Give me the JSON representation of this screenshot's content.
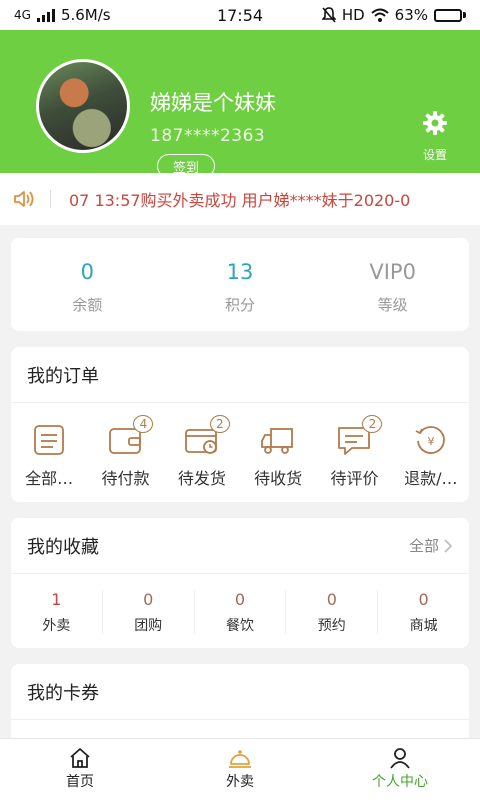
{
  "status_bar": {
    "network": "4G",
    "speed": "5.6M/s",
    "time": "17:54",
    "hd": "HD",
    "battery": "63%",
    "battery_level": 0.63
  },
  "profile": {
    "name": "娣娣是个妹妹",
    "phone": "187****2363",
    "checkin_label": "签到",
    "settings_label": "设置"
  },
  "notice": {
    "text": "07 13:57购买外卖成功   用户娣****妹于2020-0"
  },
  "stats": [
    {
      "value": "0",
      "label": "余额"
    },
    {
      "value": "13",
      "label": "积分"
    },
    {
      "value": "VIP0",
      "label": "等级"
    }
  ],
  "orders": {
    "title": "我的订单",
    "items": [
      {
        "label": "全部…",
        "icon": "clipboard-icon",
        "badge": ""
      },
      {
        "label": "待付款",
        "icon": "wallet-icon",
        "badge": "4"
      },
      {
        "label": "待发货",
        "icon": "card-clock-icon",
        "badge": "2"
      },
      {
        "label": "待收货",
        "icon": "truck-icon",
        "badge": ""
      },
      {
        "label": "待评价",
        "icon": "comment-icon",
        "badge": "2"
      },
      {
        "label": "退款/…",
        "icon": "refund-icon",
        "badge": ""
      }
    ]
  },
  "favorites": {
    "title": "我的收藏",
    "more_label": "全部",
    "items": [
      {
        "count": "1",
        "label": "外卖"
      },
      {
        "count": "0",
        "label": "团购"
      },
      {
        "count": "0",
        "label": "餐饮"
      },
      {
        "count": "0",
        "label": "预约"
      },
      {
        "count": "0",
        "label": "商城"
      }
    ]
  },
  "coupons": {
    "title": "我的卡券"
  },
  "tabbar": [
    {
      "label": "首页",
      "icon": "home-icon",
      "active": false
    },
    {
      "label": "外卖",
      "icon": "cloche-icon",
      "active": false
    },
    {
      "label": "个人中心",
      "icon": "person-icon",
      "active": true
    }
  ],
  "colors": {
    "brand_green": "#6fcf43",
    "active_tab": "#44a52e",
    "accent_red": "#c9463d",
    "stat_teal": "#2ca6b8",
    "badge_brown": "#b27a4a"
  }
}
